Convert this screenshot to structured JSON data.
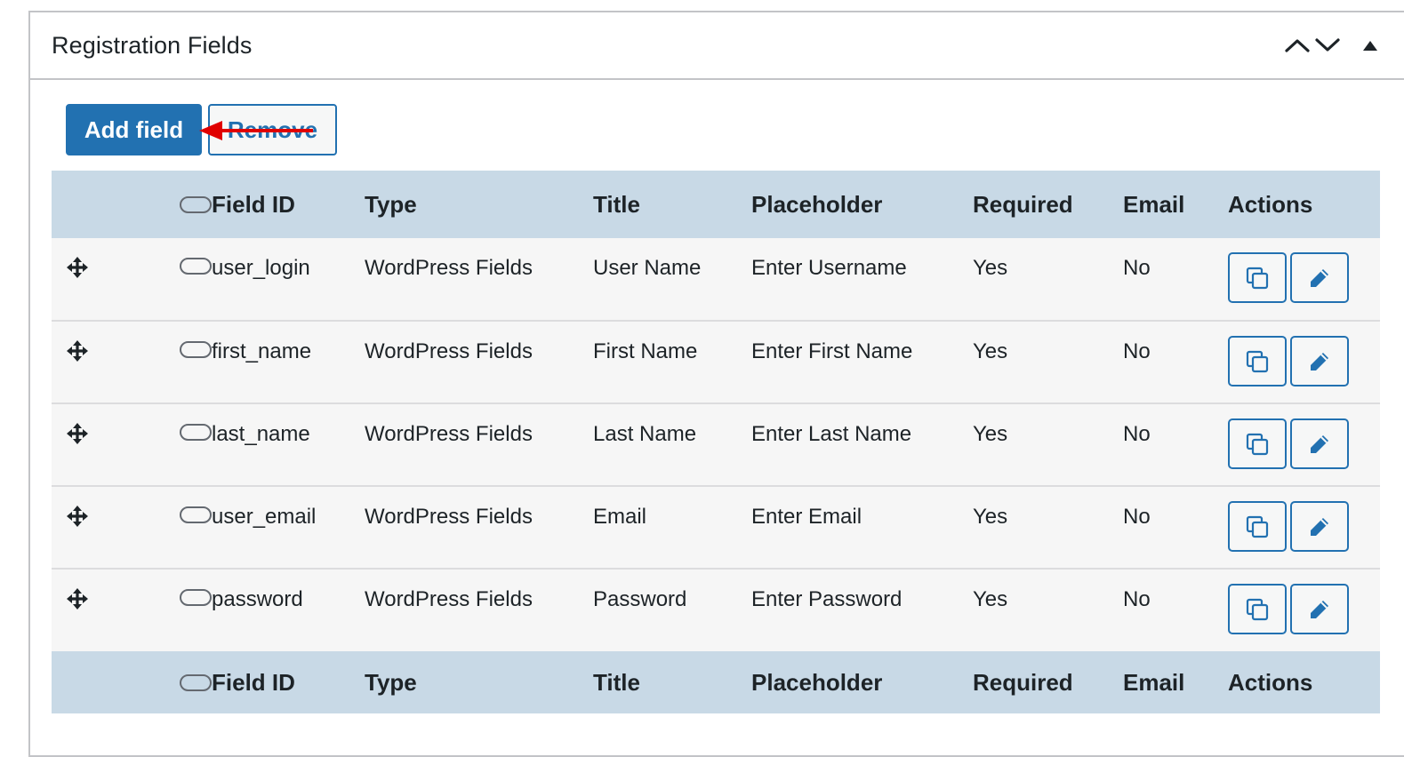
{
  "panel": {
    "title": "Registration Fields",
    "icons": [
      "chevron-up-icon",
      "chevron-down-icon",
      "caret-up-icon"
    ]
  },
  "toolbar": {
    "add_label": "Add field",
    "remove_label": "Remove"
  },
  "table": {
    "columns": [
      "Field ID",
      "Type",
      "Title",
      "Placeholder",
      "Required",
      "Email",
      "Actions"
    ],
    "rows": [
      {
        "id": "user_login",
        "type": "WordPress Fields",
        "title": "User Name",
        "placeholder": "Enter Username",
        "required": "Yes",
        "email": "No"
      },
      {
        "id": "first_name",
        "type": "WordPress Fields",
        "title": "First Name",
        "placeholder": "Enter First Name",
        "required": "Yes",
        "email": "No"
      },
      {
        "id": "last_name",
        "type": "WordPress Fields",
        "title": "Last Name",
        "placeholder": "Enter Last Name",
        "required": "Yes",
        "email": "No"
      },
      {
        "id": "user_email",
        "type": "WordPress Fields",
        "title": "Email",
        "placeholder": "Enter Email",
        "required": "Yes",
        "email": "No"
      },
      {
        "id": "password",
        "type": "WordPress Fields",
        "title": "Password",
        "placeholder": "Enter Password",
        "required": "Yes",
        "email": "No"
      }
    ],
    "row_icons": [
      "move-icon",
      "toggle-icon",
      "duplicate-icon",
      "edit-pencil-icon"
    ]
  },
  "colors": {
    "accent": "#2271b1",
    "header_bg": "#c8d9e6",
    "row_bg": "#f6f6f6",
    "annotation_arrow": "#e00000"
  }
}
